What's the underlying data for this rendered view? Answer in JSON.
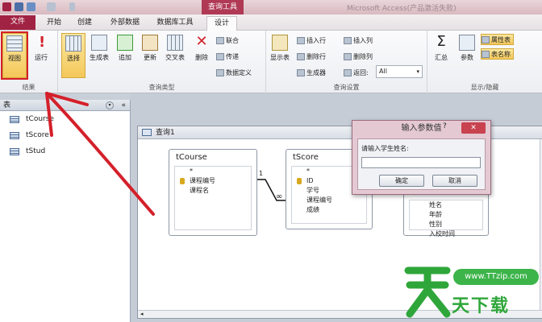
{
  "titlebar": {
    "context_tab_title": "查询工具",
    "app_title": "Microsoft Access(产品激活失败)"
  },
  "tabs": [
    "文件",
    "开始",
    "创建",
    "外部数据",
    "数据库工具",
    "设计"
  ],
  "ribbon": {
    "groups": {
      "results": "结果",
      "query_type": "查询类型",
      "query_setup": "查询设置",
      "show_hide": "显示/隐藏"
    },
    "results": {
      "view": "视图",
      "run": "运行"
    },
    "query_type": {
      "select": "选择",
      "make_table": "生成表",
      "append": "追加",
      "update": "更新",
      "crosstab": "交叉表",
      "delete": "删除",
      "union": "联合",
      "pass_through": "传递",
      "data_definition": "数据定义"
    },
    "query_setup": {
      "show_table": "显示表",
      "insert_rows": "插入行",
      "delete_rows": "删除行",
      "builder": "生成器",
      "insert_columns": "插入列",
      "delete_columns": "删除列",
      "return_label": "返回:",
      "return_value": "All"
    },
    "show_hide": {
      "totals": "汇总",
      "parameters": "参数",
      "property_sheet": "属性表",
      "table_names": "表名称"
    }
  },
  "navpane": {
    "header": "表",
    "items": [
      "tCourse",
      "tScore",
      "tStud"
    ]
  },
  "query": {
    "title": "查询1",
    "tables": [
      {
        "name": "tCourse",
        "fields": [
          "*",
          "课程编号",
          "课程名"
        ]
      },
      {
        "name": "tScore",
        "fields": [
          "*",
          "ID",
          "学号",
          "课程编号",
          "成绩"
        ]
      },
      {
        "name": "tStud",
        "fields": [
          "姓名",
          "年龄",
          "性别",
          "入校时间"
        ]
      }
    ],
    "relationship": {
      "one": "1",
      "many": "∞"
    }
  },
  "dialog": {
    "title": "输入参数值",
    "help": "?",
    "close": "✕",
    "prompt": "请输入学生姓名:",
    "value": "",
    "ok": "确定",
    "cancel": "取消"
  },
  "watermark": {
    "url": "www.TTzip.com",
    "text": "天下载"
  },
  "colors": {
    "file_tab": "#a12343",
    "context_tab": "#b03a56",
    "annotation": "#d4202a",
    "watermark": "#3cb44a"
  }
}
